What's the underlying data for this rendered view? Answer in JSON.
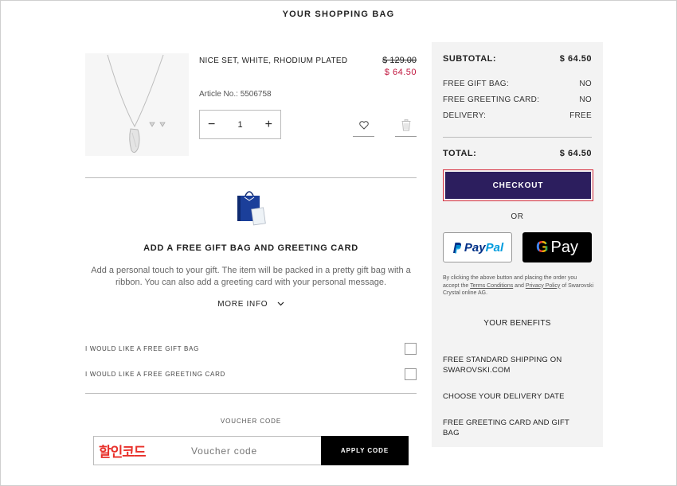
{
  "page": {
    "title": "YOUR SHOPPING BAG"
  },
  "product": {
    "name": "NICE SET, WHITE, RHODIUM PLATED",
    "price_old": "$ 129.00",
    "price_new": "$ 64.50",
    "article_label": "Article No.:",
    "article_number": "5506758",
    "quantity": "1",
    "minus": "−",
    "plus": "+"
  },
  "gift": {
    "title": "ADD A FREE GIFT BAG AND GREETING CARD",
    "description": "Add a personal touch to your gift. The item will be packed in a pretty gift bag with a ribbon. You can also add a greeting card with your personal message.",
    "more_info": "MORE INFO",
    "option_bag": "I WOULD LIKE A FREE GIFT BAG",
    "option_card": "I WOULD LIKE A FREE GREETING CARD"
  },
  "voucher": {
    "label": "VOUCHER CODE",
    "placeholder": "Voucher code",
    "apply": "APPLY CODE",
    "overlay_text": "할인코드"
  },
  "summary": {
    "subtotal_label": "SUBTOTAL:",
    "subtotal_value": "$ 64.50",
    "gift_bag_label": "FREE GIFT BAG:",
    "gift_bag_value": "NO",
    "greeting_card_label": "FREE GREETING CARD:",
    "greeting_card_value": "NO",
    "delivery_label": "DELIVERY:",
    "delivery_value": "FREE",
    "total_label": "TOTAL:",
    "total_value": "$ 64.50",
    "checkout": "CHECKOUT",
    "or": "OR",
    "paypal_pay": "Pay",
    "paypal_pal": "Pal",
    "gpay_label": "Pay",
    "legal_pre": "By clicking the above button and placing the order you accept the",
    "legal_terms": "Terms Conditions",
    "legal_and": "and",
    "legal_privacy": "Privacy Policy",
    "legal_post": "of Swarovski Crystal online AG.",
    "benefits_title": "YOUR BENEFITS",
    "benefits": [
      "FREE STANDARD SHIPPING ON SWAROVSKI.COM",
      "CHOOSE YOUR DELIVERY DATE",
      "FREE GREETING CARD AND GIFT BAG"
    ]
  },
  "colors": {
    "sale_red": "#c0143c",
    "checkout_purple": "#2c1e5e",
    "panel_bg": "#f3f3f3"
  },
  "icons": [
    "wishlist-heart-icon",
    "trash-icon",
    "chevron-down-icon",
    "paypal-logo",
    "google-pay-logo"
  ]
}
